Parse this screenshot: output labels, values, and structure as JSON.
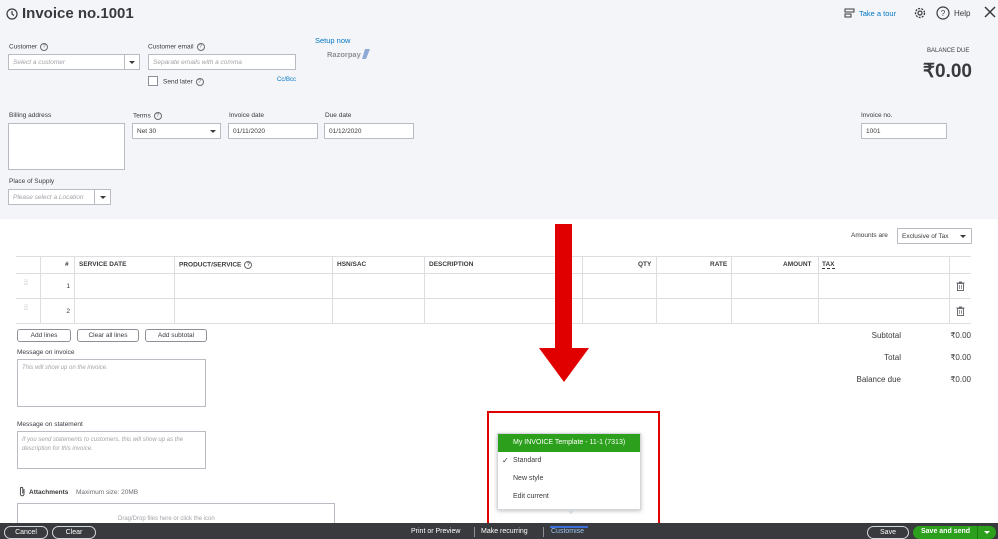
{
  "header": {
    "title": "Invoice no.1001",
    "take_tour": "Take a tour",
    "help": "Help"
  },
  "customer": {
    "label": "Customer",
    "placeholder": "Select a customer"
  },
  "email": {
    "label": "Customer email",
    "placeholder": "Separate emails with a comma",
    "send_later": "Send later",
    "ccbcc": "Cc/Bcc"
  },
  "payments": {
    "setup": "Setup now",
    "brand": "Razorpay"
  },
  "balance": {
    "label": "BALANCE DUE",
    "amount": "₹0.00"
  },
  "billing": {
    "label": "Billing address"
  },
  "terms": {
    "label": "Terms",
    "value": "Net 30"
  },
  "invoice_date": {
    "label": "Invoice date",
    "value": "01/11/2020"
  },
  "due_date": {
    "label": "Due date",
    "value": "01/12/2020"
  },
  "invoice_no": {
    "label": "Invoice no.",
    "value": "1001"
  },
  "place_of_supply": {
    "label": "Place of Supply",
    "placeholder": "Please select a Location"
  },
  "amounts": {
    "label": "Amounts are",
    "value": "Exclusive of Tax"
  },
  "table": {
    "headers": [
      "#",
      "SERVICE DATE",
      "PRODUCT/SERVICE",
      "HSN/SAC",
      "DESCRIPTION",
      "QTY",
      "RATE",
      "AMOUNT",
      "TAX"
    ],
    "rows": [
      "1",
      "2"
    ]
  },
  "line_buttons": {
    "add_lines": "Add lines",
    "clear_all": "Clear all lines",
    "add_subtotal": "Add subtotal"
  },
  "message_invoice": {
    "label": "Message on invoice",
    "placeholder": "This will show up on the invoice."
  },
  "message_statement": {
    "label": "Message on statement",
    "placeholder": "If you send statements to customers, this will show up as the description for this invoice."
  },
  "attachments": {
    "label": "Attachments",
    "max_size": "Maximum size: 20MB",
    "drop": "Drag/Drop files here or click the icon"
  },
  "totals": {
    "subtotal_label": "Subtotal",
    "subtotal_value": "₹0.00",
    "total_label": "Total",
    "total_value": "₹0.00",
    "balance_label": "Balance due",
    "balance_value": "₹0.00"
  },
  "template_menu": {
    "selected": "My INVOICE Template - 11-1 (7313)",
    "items": [
      "Standard",
      "New style",
      "Edit current"
    ]
  },
  "footer": {
    "cancel": "Cancel",
    "clear": "Clear",
    "print_preview": "Print or Preview",
    "make_recurring": "Make recurring",
    "customise": "Customise",
    "save": "Save",
    "save_send": "Save and send"
  },
  "colors": {
    "accent_green": "#2ca01c",
    "annotation_red": "#e00000",
    "footer_dark": "#393a3d",
    "link_blue": "#0077c5"
  }
}
